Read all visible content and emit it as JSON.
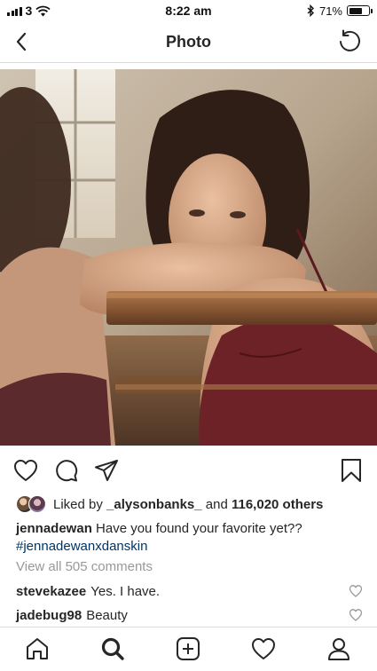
{
  "status_bar": {
    "carrier": "3",
    "time": "8:22 am",
    "battery": "71%",
    "battery_level": 0.71,
    "icons": [
      "signal-icon",
      "wifi-icon",
      "bluetooth-icon",
      "battery-icon"
    ]
  },
  "nav": {
    "title": "Photo",
    "back_icon": "chevron-left-icon",
    "refresh_icon": "refresh-icon"
  },
  "post": {
    "actions": {
      "icons": [
        "heart-icon",
        "comment-icon",
        "share-icon",
        "bookmark-icon"
      ]
    },
    "likes": {
      "prefix": "Liked by",
      "user": "_alysonbanks_",
      "middle": "and",
      "count": "116,020 others"
    },
    "caption": {
      "user": "jennadewan",
      "text": "Have you found your favorite yet??",
      "hashtag": "#jennadewanxdanskin"
    },
    "view_all": "View all 505 comments",
    "comments": [
      {
        "user": "stevekazee",
        "text": "Yes. I have."
      },
      {
        "user": "jadebug98",
        "text": "Beauty"
      }
    ]
  },
  "tabbar": {
    "icons": [
      "home-icon",
      "search-icon",
      "add-post-icon",
      "activity-heart-icon",
      "profile-icon"
    ]
  },
  "colors": {
    "text": "#262626",
    "muted": "#999999",
    "hashtag": "#003569",
    "divider": "#dbdbdb"
  }
}
